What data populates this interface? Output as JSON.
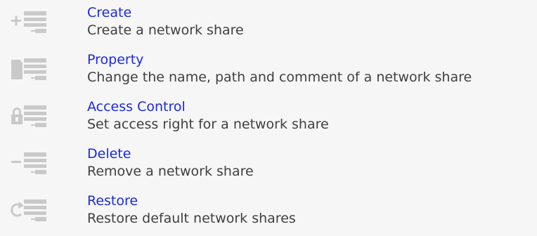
{
  "actions": [
    {
      "title": "Create",
      "description": "Create a network share",
      "icon": "create-share-icon"
    },
    {
      "title": "Property",
      "description": "Change the name, path and comment of a network share",
      "icon": "property-share-icon"
    },
    {
      "title": "Access Control",
      "description": "Set access right for a network share",
      "icon": "access-control-icon"
    },
    {
      "title": "Delete",
      "description": "Remove a network share",
      "icon": "delete-share-icon"
    },
    {
      "title": "Restore",
      "description": "Restore default network shares",
      "icon": "restore-share-icon"
    }
  ],
  "colors": {
    "link": "#1b2bd6",
    "text": "#3f3f3f",
    "icon": "#c4c4c4",
    "background": "#f6f6f6"
  }
}
